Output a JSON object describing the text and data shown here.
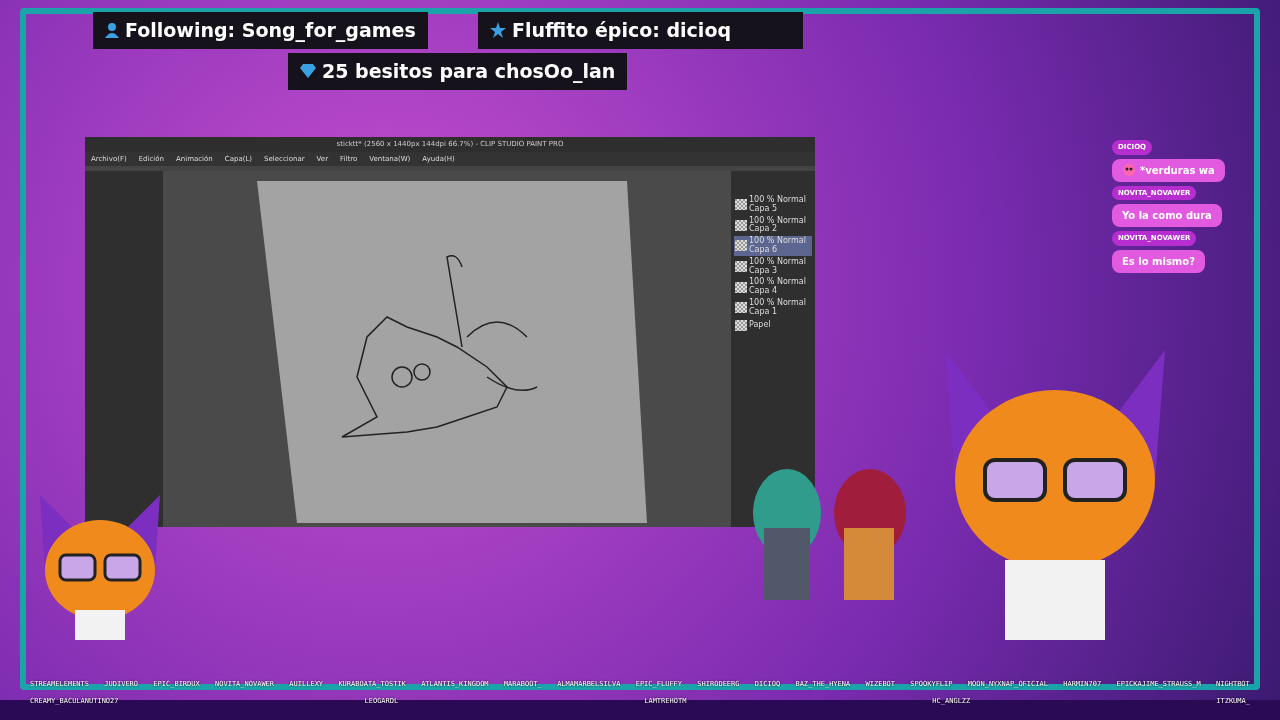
{
  "alerts": [
    {
      "kind": "person",
      "text": "Following: Song_for_games"
    },
    {
      "kind": "star",
      "text": "Fluffito épico: dicioq"
    },
    {
      "kind": "diamond",
      "text": "25 besitos para chosOo_lan"
    }
  ],
  "app": {
    "title": "sticktt* (2560 x 1440px 144dpi 66.7%) - CLIP STUDIO PAINT PRO",
    "menu": [
      "Archivo(F)",
      "Edición",
      "Animación",
      "Capa(L)",
      "Seleccionar",
      "Ver",
      "Filtro",
      "Ventana(W)",
      "Ayuda(H)"
    ],
    "layers": [
      {
        "mode": "100 % Normal",
        "name": "Capa 5",
        "selected": false
      },
      {
        "mode": "100 % Normal",
        "name": "Capa 2",
        "selected": false
      },
      {
        "mode": "100 % Normal",
        "name": "Capa 6",
        "selected": true
      },
      {
        "mode": "100 % Normal",
        "name": "Capa 3",
        "selected": false
      },
      {
        "mode": "100 % Normal",
        "name": "Capa 4",
        "selected": false
      },
      {
        "mode": "100 % Normal",
        "name": "Capa 1",
        "selected": false
      },
      {
        "name": "Papel",
        "selected": false
      }
    ]
  },
  "chat": [
    {
      "user": "DICIOQ",
      "text": "*verduras wa",
      "emote": true
    },
    {
      "user": "NOVITA_NOVAWER",
      "text": "Yo la como dura",
      "emote": false
    },
    {
      "user": "NOVITA_NOVAWER",
      "text": "Es lo mismo?",
      "emote": false
    }
  ],
  "viewers": [
    "STREAMELEMENTS",
    "JUDIVERO",
    "EPIC_BIRDUX",
    "NOVITA_NOVAWER",
    "AUILLEXY",
    "KURABOATA_TOSTIK",
    "ATLANTIS_KINGDOM",
    "MARABOOT_",
    "ALMAMARBELSILVA",
    "EPIC_FLUFFY",
    "SHIRODEERG",
    "DICIOQ",
    "BAZ_THE_HYENA",
    "WIZEBOT",
    "SPOOKYFLIP",
    "MOON_NYXNAP_OFICIAL",
    "HARMIN707",
    "EPICKAJIME_STRAUSS_M",
    "NIGHTBOT",
    "CREAMY_BACULANUTINO27",
    "LEOGARDL",
    "LAMTREHOTM",
    "HC_ANGLZZ",
    "ITZKUMA_"
  ]
}
